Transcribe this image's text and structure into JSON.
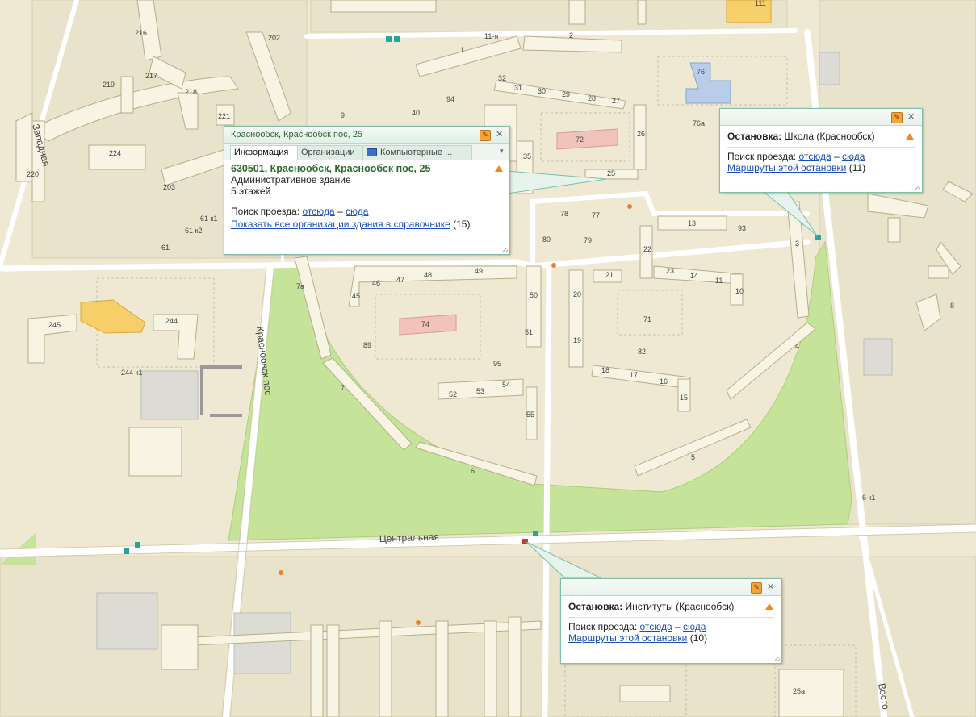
{
  "map": {
    "streets": {
      "central": "Центральная",
      "krasnoobsk": "Красноовск пос",
      "zapadnaya": "Западная",
      "eleventh": "11-я",
      "vostochnaya": "Восто"
    },
    "buildings": [
      "1",
      "2",
      "3",
      "4",
      "5",
      "6",
      "7",
      "7a",
      "9",
      "10",
      "11",
      "13",
      "14",
      "15",
      "16",
      "17",
      "18",
      "19",
      "20",
      "21",
      "22",
      "23",
      "25",
      "26",
      "27",
      "28",
      "29",
      "30",
      "31",
      "32",
      "35",
      "40",
      "45",
      "46",
      "47",
      "48",
      "49",
      "50",
      "51",
      "52",
      "53",
      "54",
      "55",
      "61",
      "61 к1",
      "61 к2",
      "71",
      "72",
      "74",
      "76",
      "76а",
      "77",
      "78",
      "79",
      "80",
      "82",
      "89",
      "93",
      "94",
      "95",
      "111",
      "202",
      "203",
      "216",
      "217",
      "218",
      "219",
      "220",
      "221",
      "224",
      "244",
      "244 к1",
      "245",
      "25а",
      "6 к1",
      "8"
    ]
  },
  "popup_building": {
    "title": "Краснообск, Краснообск пос, 25",
    "tabs": [
      "Информация",
      "Организации",
      "Компьютерные ..."
    ],
    "address": "630501, Краснообск, Краснообск пос, 25",
    "type": "Административное здание",
    "floors": "5 этажей",
    "route_label": "Поиск проезда:",
    "from_here": "отсюда",
    "dash": "–",
    "to_here": "сюда",
    "orgs_link": "Показать все организации здания в справочнике",
    "orgs_count": "(15)"
  },
  "popup_stop_school": {
    "stop_label": "Остановка:",
    "stop_name": "Школа (Краснообск)",
    "route_label": "Поиск проезда:",
    "from_here": "отсюда",
    "dash": "–",
    "to_here": "сюда",
    "routes_link": "Маршруты этой остановки",
    "routes_count": "(11)"
  },
  "popup_stop_institutes": {
    "stop_label": "Остановка:",
    "stop_name": "Институты (Краснообск)",
    "route_label": "Поиск проезда:",
    "from_here": "отсюда",
    "dash": "–",
    "to_here": "сюда",
    "routes_link": "Маршруты этой остановки",
    "routes_count": "(10)"
  },
  "colors": {
    "background": "#efe9d4",
    "park": "#c6e39a",
    "road": "#ffffff",
    "building": "#f7f4e3",
    "school": "#b8cdea",
    "highlight": "#f6cf6b",
    "kindergarten": "#f2c3bb",
    "accent": "#2c6a2c"
  }
}
